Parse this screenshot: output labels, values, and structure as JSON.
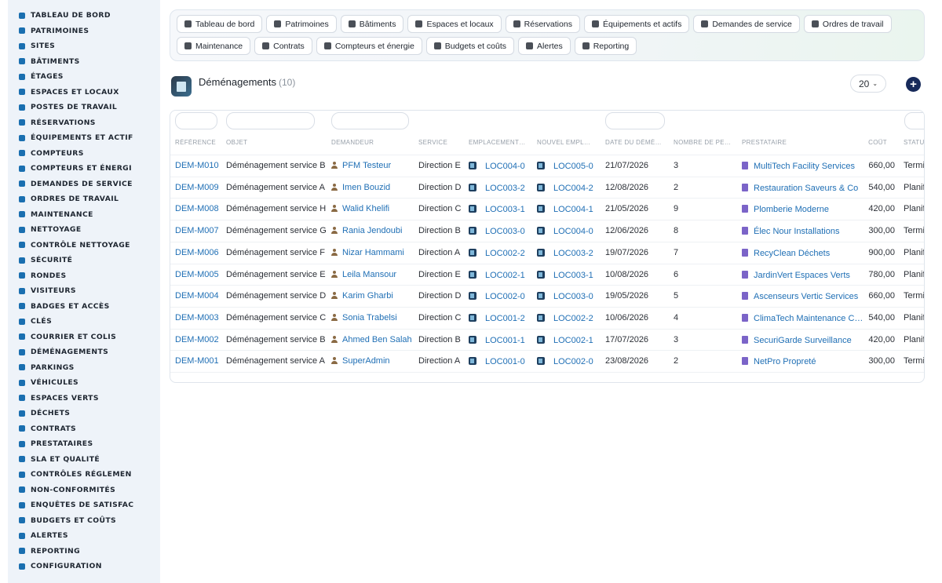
{
  "sidebar": {
    "items": [
      {
        "label": "Tableau de bord",
        "icon": "dashboard-icon"
      },
      {
        "label": "Patrimoines",
        "icon": "building-columns-icon"
      },
      {
        "label": "Sites",
        "icon": "map-pin-icon"
      },
      {
        "label": "Bâtiments",
        "icon": "building-icon"
      },
      {
        "label": "Étages",
        "icon": "layers-icon"
      },
      {
        "label": "Espaces et locaux",
        "icon": "door-icon"
      },
      {
        "label": "Postes de travail",
        "icon": "desktop-icon"
      },
      {
        "label": "Réservations",
        "icon": "calendar-icon"
      },
      {
        "label": "Équipements et actif",
        "icon": "cogs-icon"
      },
      {
        "label": "Compteurs",
        "icon": "gauge-icon"
      },
      {
        "label": "Compteurs et énergi",
        "icon": "bolt-icon"
      },
      {
        "label": "Demandes de service",
        "icon": "clipboard-icon"
      },
      {
        "label": "Ordres de travail",
        "icon": "tools-icon"
      },
      {
        "label": "Maintenance",
        "icon": "wrench-icon"
      },
      {
        "label": "Nettoyage",
        "icon": "broom-icon"
      },
      {
        "label": "Contrôle nettoyage",
        "icon": "check-brush-icon"
      },
      {
        "label": "Sécurité",
        "icon": "shield-icon"
      },
      {
        "label": "Rondes",
        "icon": "route-icon"
      },
      {
        "label": "Visiteurs",
        "icon": "id-card-icon"
      },
      {
        "label": "Badges et accès",
        "icon": "badge-icon"
      },
      {
        "label": "Clés",
        "icon": "key-icon"
      },
      {
        "label": "Courrier et colis",
        "icon": "mail-icon"
      },
      {
        "label": "Déménagements",
        "icon": "truck-ramp-icon"
      },
      {
        "label": "Parkings",
        "icon": "parking-icon"
      },
      {
        "label": "Véhicules",
        "icon": "car-icon"
      },
      {
        "label": "Espaces verts",
        "icon": "leaf-icon"
      },
      {
        "label": "Déchets",
        "icon": "recycle-icon"
      },
      {
        "label": "Contrats",
        "icon": "file-icon"
      },
      {
        "label": "Prestataires",
        "icon": "handshake-icon"
      },
      {
        "label": "SLA et qualité",
        "icon": "star-badge-icon"
      },
      {
        "label": "Contrôles réglemen",
        "icon": "clipboard-check-icon"
      },
      {
        "label": "Non-conformités",
        "icon": "alert-circle-icon"
      },
      {
        "label": "Enquêtes de satisfac",
        "icon": "star-icon"
      },
      {
        "label": "Budgets et coûts",
        "icon": "coins-icon"
      },
      {
        "label": "Alertes",
        "icon": "bell-icon"
      },
      {
        "label": "Reporting",
        "icon": "chart-pie-icon"
      },
      {
        "label": "Configuration",
        "icon": "gear-icon"
      }
    ]
  },
  "topnav": {
    "row1": [
      {
        "label": "Tableau de bord",
        "icon": "dashboard-icon"
      },
      {
        "label": "Patrimoines",
        "icon": "building-columns-icon"
      },
      {
        "label": "Bâtiments",
        "icon": "building-icon"
      },
      {
        "label": "Espaces et locaux",
        "icon": "door-icon"
      },
      {
        "label": "Réservations",
        "icon": "calendar-icon"
      },
      {
        "label": "Équipements et actifs",
        "icon": "cogs-icon"
      },
      {
        "label": "Demandes de service",
        "icon": "clipboard-icon"
      },
      {
        "label": "Ordres de travail",
        "icon": "tools-icon"
      }
    ],
    "row2": [
      {
        "label": "Maintenance",
        "icon": "wrench-icon"
      },
      {
        "label": "Contrats",
        "icon": "file-icon"
      },
      {
        "label": "Compteurs et énergie",
        "icon": "bolt-icon"
      },
      {
        "label": "Budgets et coûts",
        "icon": "coins-icon"
      },
      {
        "label": "Alertes",
        "icon": "bell-icon"
      },
      {
        "label": "Reporting",
        "icon": "chart-pie-icon"
      }
    ]
  },
  "page": {
    "title": "Déménagements",
    "count": "(10)",
    "per_page": "20",
    "accent": "#172a5a"
  },
  "table": {
    "headers": [
      "Référence",
      "Objet",
      "Demandeur",
      "Service",
      "Emplacement…",
      "Nouvel empl…",
      "Date du démé…",
      "Nombre de pe…",
      "Prestataire",
      "Coût",
      "Statu"
    ],
    "rows": [
      {
        "ref": "DEM-M010",
        "objet": "Déménagement service B",
        "demandeur": "PFM Testeur",
        "service": "Direction E",
        "emplacement": "LOC004-0",
        "nouvel": "LOC005-0",
        "date": "21/07/2026",
        "nombre": "3",
        "prestataire": "MultiTech Facility Services",
        "cout": "660,00",
        "statut": "Termi"
      },
      {
        "ref": "DEM-M009",
        "objet": "Déménagement service A",
        "demandeur": "Imen Bouzid",
        "service": "Direction D",
        "emplacement": "LOC003-2",
        "nouvel": "LOC004-2",
        "date": "12/08/2026",
        "nombre": "2",
        "prestataire": "Restauration Saveurs & Co",
        "cout": "540,00",
        "statut": "Planif"
      },
      {
        "ref": "DEM-M008",
        "objet": "Déménagement service H",
        "demandeur": "Walid Khelifi",
        "service": "Direction C",
        "emplacement": "LOC003-1",
        "nouvel": "LOC004-1",
        "date": "21/05/2026",
        "nombre": "9",
        "prestataire": "Plomberie Moderne",
        "cout": "420,00",
        "statut": "Planif"
      },
      {
        "ref": "DEM-M007",
        "objet": "Déménagement service G",
        "demandeur": "Rania Jendoubi",
        "service": "Direction B",
        "emplacement": "LOC003-0",
        "nouvel": "LOC004-0",
        "date": "12/06/2026",
        "nombre": "8",
        "prestataire": "Élec Nour Installations",
        "cout": "300,00",
        "statut": "Termi"
      },
      {
        "ref": "DEM-M006",
        "objet": "Déménagement service F",
        "demandeur": "Nizar Hammami",
        "service": "Direction A",
        "emplacement": "LOC002-2",
        "nouvel": "LOC003-2",
        "date": "19/07/2026",
        "nombre": "7",
        "prestataire": "RecyClean Déchets",
        "cout": "900,00",
        "statut": "Planif"
      },
      {
        "ref": "DEM-M005",
        "objet": "Déménagement service E",
        "demandeur": "Leila Mansour",
        "service": "Direction E",
        "emplacement": "LOC002-1",
        "nouvel": "LOC003-1",
        "date": "10/08/2026",
        "nombre": "6",
        "prestataire": "JardinVert Espaces Verts",
        "cout": "780,00",
        "statut": "Planif"
      },
      {
        "ref": "DEM-M004",
        "objet": "Déménagement service D",
        "demandeur": "Karim Gharbi",
        "service": "Direction D",
        "emplacement": "LOC002-0",
        "nouvel": "LOC003-0",
        "date": "19/05/2026",
        "nombre": "5",
        "prestataire": "Ascenseurs Vertic Services",
        "cout": "660,00",
        "statut": "Termi"
      },
      {
        "ref": "DEM-M003",
        "objet": "Déménagement service C",
        "demandeur": "Sonia Trabelsi",
        "service": "Direction C",
        "emplacement": "LOC001-2",
        "nouvel": "LOC002-2",
        "date": "10/06/2026",
        "nombre": "4",
        "prestataire": "ClimaTech Maintenance C…",
        "cout": "540,00",
        "statut": "Planif"
      },
      {
        "ref": "DEM-M002",
        "objet": "Déménagement service B",
        "demandeur": "Ahmed Ben Salah",
        "service": "Direction B",
        "emplacement": "LOC001-1",
        "nouvel": "LOC002-1",
        "date": "17/07/2026",
        "nombre": "3",
        "prestataire": "SecuriGarde Surveillance",
        "cout": "420,00",
        "statut": "Planif"
      },
      {
        "ref": "DEM-M001",
        "objet": "Déménagement service A",
        "demandeur": "SuperAdmin",
        "service": "Direction A",
        "emplacement": "LOC001-0",
        "nouvel": "LOC002-0",
        "date": "23/08/2026",
        "nombre": "2",
        "prestataire": "NetPro Propreté",
        "cout": "300,00",
        "statut": "Termi"
      }
    ]
  }
}
